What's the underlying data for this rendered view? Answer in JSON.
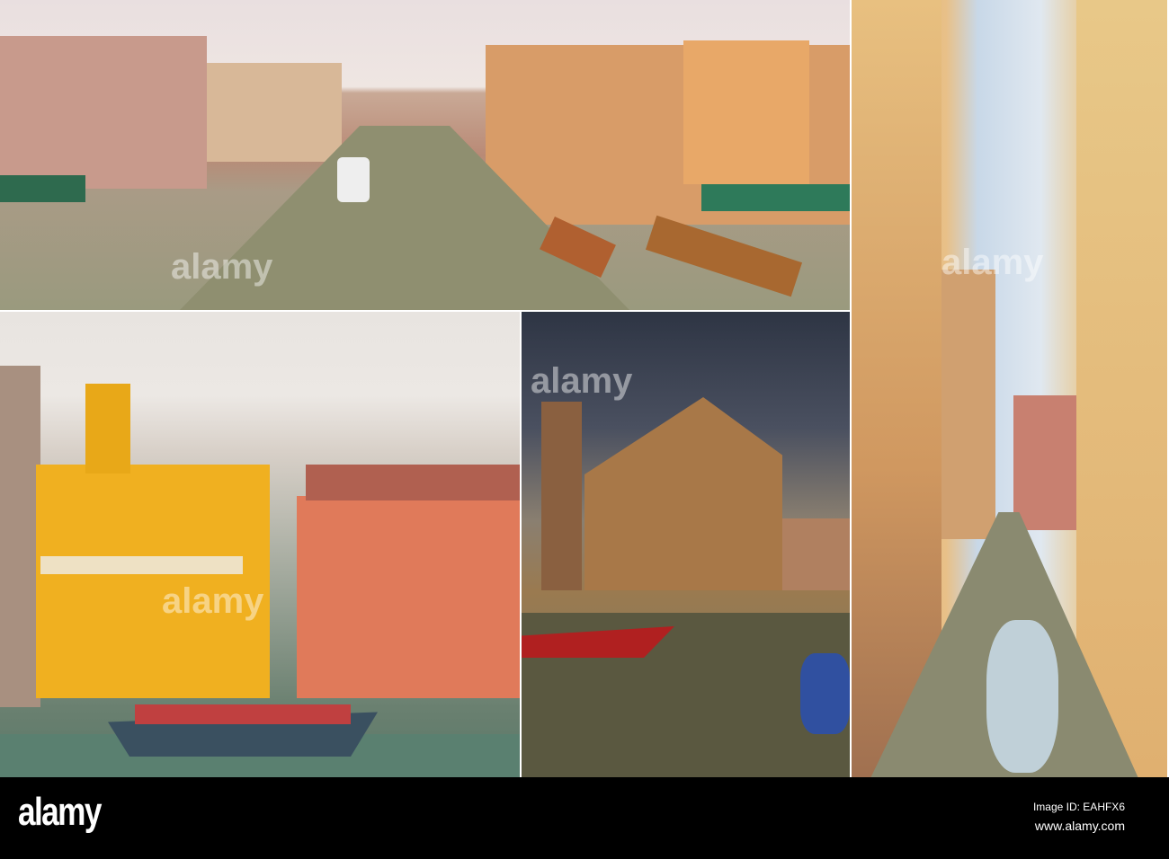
{
  "watermark": "alamy",
  "footer": {
    "logo": "alamy",
    "image_id": "Image ID: EAHFX6",
    "website": "www.alamy.com"
  }
}
